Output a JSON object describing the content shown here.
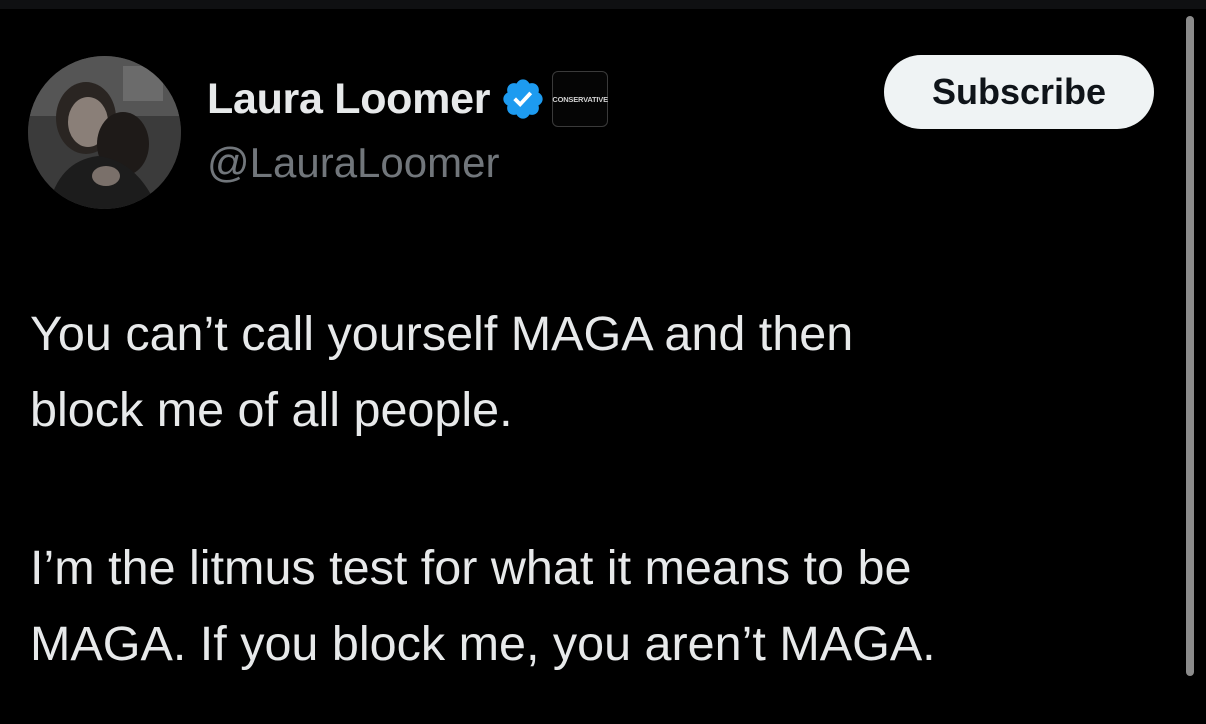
{
  "tweet": {
    "author": {
      "display_name": "Laura Loomer",
      "handle": "@LauraLoomer",
      "verified_icon": "verified-badge-icon",
      "affiliate_badge_text": "CONSERVATIVE"
    },
    "subscribe_label": "Subscribe",
    "paragraphs": [
      [
        "You can’t call yourself MAGA and then",
        "block me of all people."
      ],
      [
        "I’m the litmus test for what it means to be",
        "MAGA. If you block me, you aren’t MAGA."
      ]
    ]
  },
  "colors": {
    "background": "#000000",
    "text_primary": "#e7e9ea",
    "text_secondary": "#71767b",
    "verified_blue": "#1d9bf0",
    "button_bg": "#eff3f4",
    "button_text": "#0f1419"
  }
}
